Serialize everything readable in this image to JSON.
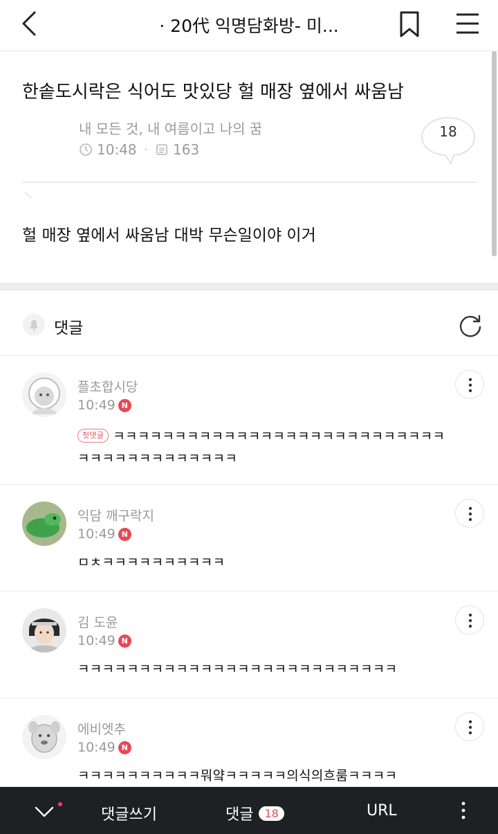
{
  "header": {
    "title": "· 20代 익명담화방- 미..."
  },
  "post": {
    "title": "한솥도시락은 식어도 맛있당 헐 매장 옆에서 싸움남",
    "author": "내 모든 것, 내 여름이고 나의 꿈",
    "time": "10:48",
    "views": "163",
    "comment_count": "18",
    "body": "헐 매장 옆에서 싸움남 대박 무슨일이야 이거"
  },
  "comments_section": {
    "label": "댓글"
  },
  "comments": [
    {
      "name": "플초합시당",
      "time": "10:49",
      "badge": "N",
      "first_tag": "첫댓글",
      "line1": "ㅋㅋㅋㅋㅋㅋㅋㅋㅋㅋㅋㅋㅋㅋㅋㅋㅋㅋㅋㅋㅋㅋㅋㅋㅋㅋㅋ",
      "line2": "ㅋㅋㅋㅋㅋㅋㅋㅋㅋㅋㅋㅋㅋ"
    },
    {
      "name": "익담 깨구락지",
      "time": "10:49",
      "badge": "N",
      "line1": "ㅁㅊㅋㅋㅋㅋㅋㅋㅋㅋㅋㅋ"
    },
    {
      "name": "김 도윤",
      "time": "10:49",
      "badge": "N",
      "line1": "ㅋㅋㅋㅋㅋㅋㅋㅋㅋㅋㅋㅋㅋㅋㅋㅋㅋㅋㅋㅋㅋㅋㅋㅋㅋㅋ"
    },
    {
      "name": "에비엣추",
      "time": "10:49",
      "badge": "N",
      "line1": "ㅋㅋㅋㅋㅋㅋㅋㅋㅋㅋ뭐얔ㅋㅋㅋㅋㅋ의식의흐룸ㅋㅋㅋㅋ"
    }
  ],
  "bottom_bar": {
    "write": "댓글쓰기",
    "comments": "댓글",
    "comments_count": "18",
    "url": "URL"
  },
  "colors": {
    "accent_red": "#e94856",
    "bottom_bar_bg": "#1f2023",
    "muted_text": "#9a9a9a"
  }
}
